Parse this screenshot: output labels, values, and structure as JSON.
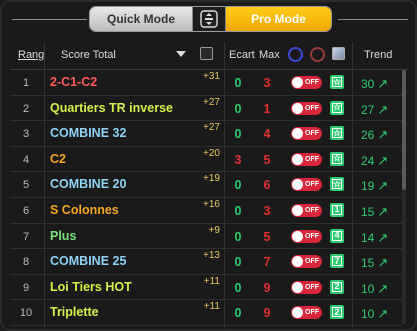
{
  "mode": {
    "quick_label": "Quick Mode",
    "pro_label": "Pro Mode",
    "active": "Pro Mode"
  },
  "header": {
    "rang": "Rang",
    "score_total": "Score Total",
    "ecart": "Ecart",
    "max": "Max",
    "trend": "Trend"
  },
  "colors": {
    "pro_accent": "#f5b400",
    "max_red": "#e03030",
    "ecart_green": "#2ecc71",
    "toggle_off": "#d9263a",
    "badge_green": "#2ecc71",
    "score_gold": "#e8c860"
  },
  "rows": [
    {
      "rang": "1",
      "name": "2-C1-C2",
      "name_color": "#ff5a5a",
      "score": "+31",
      "ecart": "0",
      "ecart_color": "#2ecc71",
      "max": "3",
      "toggle": "OFF",
      "badge": "☆",
      "trend": "30"
    },
    {
      "rang": "2",
      "name": "Quartiers TR inverse",
      "name_color": "#d6f04a",
      "score": "+27",
      "ecart": "0",
      "ecart_color": "#2ecc71",
      "max": "1",
      "toggle": "OFF",
      "badge": "☆",
      "trend": "27"
    },
    {
      "rang": "3",
      "name": "COMBINE 32",
      "name_color": "#8fd3f5",
      "score": "+27",
      "ecart": "0",
      "ecart_color": "#2ecc71",
      "max": "4",
      "toggle": "OFF",
      "badge": "☆",
      "trend": "26"
    },
    {
      "rang": "4",
      "name": "C2",
      "name_color": "#f5a623",
      "score": "+20",
      "ecart": "3",
      "ecart_color": "#e03030",
      "max": "5",
      "toggle": "OFF",
      "badge": "☆",
      "trend": "24"
    },
    {
      "rang": "5",
      "name": "COMBINE 20",
      "name_color": "#8fd3f5",
      "score": "+19",
      "ecart": "0",
      "ecart_color": "#2ecc71",
      "max": "6",
      "toggle": "OFF",
      "badge": "☆",
      "trend": "19"
    },
    {
      "rang": "6",
      "name": "S Colonnes",
      "name_color": "#f5a623",
      "score": "+16",
      "ecart": "0",
      "ecart_color": "#2ecc71",
      "max": "3",
      "toggle": "OFF",
      "badge": "1",
      "trend": "15"
    },
    {
      "rang": "7",
      "name": "Plus",
      "name_color": "#7de07d",
      "score": "+9",
      "ecart": "0",
      "ecart_color": "#2ecc71",
      "max": "5",
      "toggle": "OFF",
      "badge": "4",
      "trend": "14"
    },
    {
      "rang": "8",
      "name": "COMBINE 25",
      "name_color": "#8fd3f5",
      "score": "+13",
      "ecart": "0",
      "ecart_color": "#2ecc71",
      "max": "7",
      "toggle": "OFF",
      "badge": "7",
      "trend": "15"
    },
    {
      "rang": "9",
      "name": "Loi Tiers HOT",
      "name_color": "#d6f04a",
      "score": "+11",
      "ecart": "0",
      "ecart_color": "#2ecc71",
      "max": "9",
      "toggle": "OFF",
      "badge": "2",
      "trend": "10"
    },
    {
      "rang": "10",
      "name": "Triplette",
      "name_color": "#d6f04a",
      "score": "+11",
      "ecart": "0",
      "ecart_color": "#2ecc71",
      "max": "9",
      "toggle": "OFF",
      "badge": "2",
      "trend": "10"
    }
  ],
  "icons": {
    "trend": "arrow-up-right-icon",
    "toggle": "toggle-off-icon",
    "star": "star-icon"
  }
}
